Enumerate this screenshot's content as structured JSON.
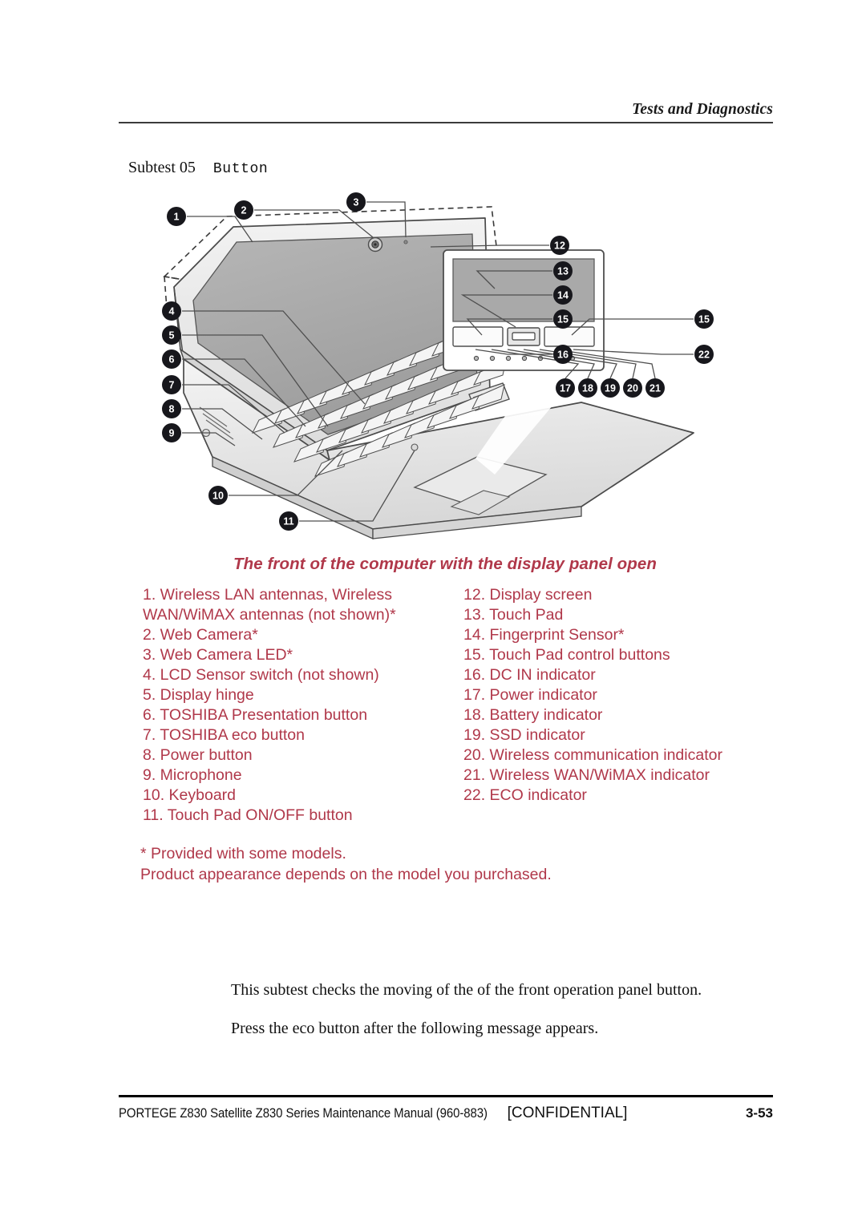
{
  "header": {
    "title": "Tests and Diagnostics"
  },
  "subtest": {
    "label": "Subtest 05",
    "value": "Button"
  },
  "figure": {
    "caption": "The front of the computer with the display panel open",
    "callouts": [
      "1",
      "2",
      "3",
      "4",
      "5",
      "6",
      "7",
      "8",
      "9",
      "10",
      "11",
      "12",
      "13",
      "14",
      "15",
      "15",
      "16",
      "17",
      "18",
      "19",
      "20",
      "21",
      "22"
    ],
    "accent_color": "#b0384a",
    "line_color": "#555555",
    "screen_fill": "#a8a8a8",
    "body_fill": "#e4e4e4"
  },
  "legend": {
    "left": [
      "1. Wireless LAN antennas, Wireless",
      "WAN/WiMAX antennas (not shown)*",
      "2. Web Camera*",
      "3. Web Camera LED*",
      "4. LCD Sensor switch (not shown)",
      "5. Display hinge",
      "6. TOSHIBA Presentation button",
      "7. TOSHIBA eco button",
      "8. Power button",
      "9. Microphone",
      "10. Keyboard",
      "11. Touch Pad ON/OFF button"
    ],
    "right": [
      "12. Display screen",
      "",
      "13. Touch Pad",
      "14. Fingerprint Sensor*",
      "15. Touch Pad control buttons",
      "16. DC IN indicator",
      "17. Power indicator",
      "18. Battery indicator",
      "19. SSD indicator",
      "20. Wireless communication indicator",
      "21. Wireless WAN/WiMAX indicator",
      "22. ECO indicator"
    ]
  },
  "footnote": {
    "line1": "* Provided with some models.",
    "line2": "Product appearance depends on the model you purchased."
  },
  "body": {
    "paragraph1": "This subtest checks the moving of the of the front operation panel button.",
    "paragraph2": "Press the eco button after the following message appears."
  },
  "footer": {
    "manual": "PORTEGE Z830 Satellite Z830 Series Maintenance Manual (960-883)",
    "confidential": "[CONFIDENTIAL]",
    "page": "3-53"
  }
}
